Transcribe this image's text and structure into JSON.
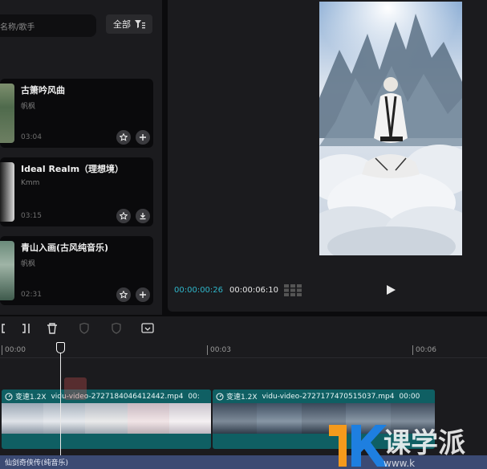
{
  "search": {
    "placeholder": "名称/歌手"
  },
  "filter": {
    "label": "全部"
  },
  "songs": [
    {
      "title": "古箫吟风曲",
      "artist": "帆枫",
      "duration": "03:04",
      "action": "add"
    },
    {
      "title": "Ideal Realm（理想境）",
      "artist": "Kmm",
      "duration": "03:15",
      "action": "download"
    },
    {
      "title": "青山入画(古风纯音乐)",
      "artist": "帆枫",
      "duration": "02:31",
      "action": "add"
    }
  ],
  "preview": {
    "current_time": "00:00:00:26",
    "total_time": "00:00:06:10"
  },
  "ruler": {
    "labels": [
      "00:00",
      "00:03",
      "00:06"
    ]
  },
  "clips": [
    {
      "speed": "变速1.2X",
      "filename": "vidu-video-2727184046412442.mp4",
      "time": "00:"
    },
    {
      "speed": "变速1.2X",
      "filename": "vidu-video-2727177470515037.mp4",
      "time": "00:00"
    }
  ],
  "audio": {
    "label": "仙剑奇侠传(纯音乐)"
  },
  "watermark": {
    "text": "课学派",
    "sub": "www.k"
  },
  "colors": {
    "accent": "#2fb6ca",
    "clip": "#0f5f63",
    "audio": "#3b4a73",
    "panel": "#1b1b1e"
  }
}
